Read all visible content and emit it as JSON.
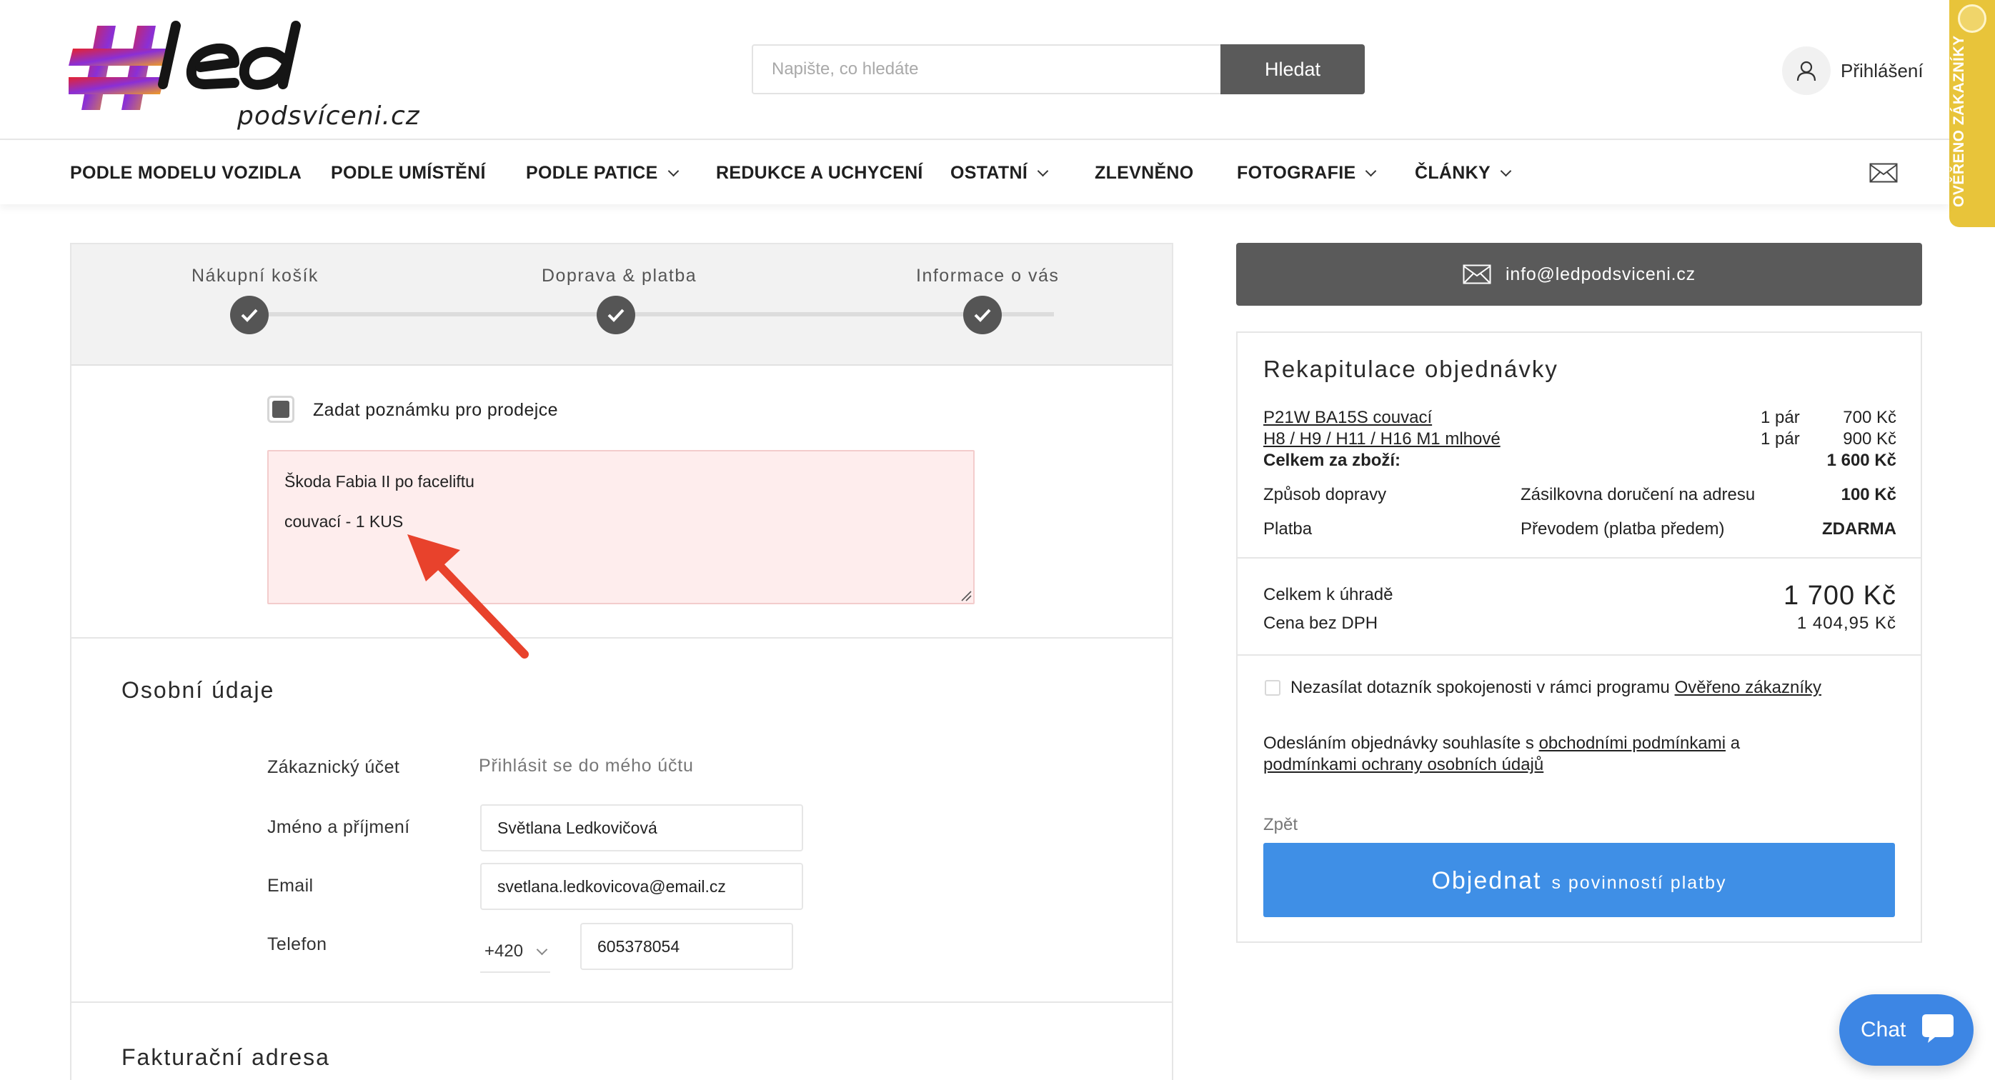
{
  "header": {
    "logo_sub": "podsvíceni.cz",
    "search_placeholder": "Napište, co hledáte",
    "search_button": "Hledat",
    "login_label": "Přihlášení",
    "badge_text": "OVĚŘENO ZÁKAZNÍKY"
  },
  "nav": {
    "items": [
      {
        "label": "PODLE MODELU VOZIDLA",
        "dropdown": false
      },
      {
        "label": "PODLE UMÍSTĚNÍ",
        "dropdown": false
      },
      {
        "label": "PODLE PATICE",
        "dropdown": true
      },
      {
        "label": "REDUKCE A UCHYCENÍ",
        "dropdown": false
      },
      {
        "label": "OSTATNÍ",
        "dropdown": true
      },
      {
        "label": "ZLEVNĚNO",
        "dropdown": false
      },
      {
        "label": "FOTOGRAFIE",
        "dropdown": true
      },
      {
        "label": "ČLÁNKY",
        "dropdown": true
      }
    ]
  },
  "steps": [
    {
      "label": "Nákupní košík",
      "done": true
    },
    {
      "label": "Doprava & platba",
      "done": true
    },
    {
      "label": "Informace o vás",
      "done": true
    }
  ],
  "note": {
    "checkbox_label": "Zadat poznámku pro prodejce",
    "checked": true,
    "lines": [
      "Škoda Fabia II po faceliftu",
      "couvací - 1 KUS"
    ]
  },
  "personal": {
    "title": "Osobní údaje",
    "account_label": "Zákaznický účet",
    "account_link": "Přihlásit se do mého účtu",
    "name_label": "Jméno a příjmení",
    "name_value": "Světlana Ledkovičová",
    "email_label": "Email",
    "email_value": "svetlana.ledkovicova@email.cz",
    "phone_label": "Telefon",
    "phone_prefix": "+420",
    "phone_value": "605378054"
  },
  "billing": {
    "title": "Fakturační adresa"
  },
  "sidebar": {
    "email": "info@ledpodsviceni.cz",
    "recap_title": "Rekapitulace objednávky",
    "items": [
      {
        "name": "P21W BA15S couvací",
        "qty": "1 pár",
        "price": "700 Kč"
      },
      {
        "name": "H8 / H9 / H11 / H16 M1 mlhové",
        "qty": "1 pár",
        "price": "900 Kč"
      }
    ],
    "goods_total_label": "Celkem za zboží:",
    "goods_total": "1 600 Kč",
    "shipping_label": "Způsob dopravy",
    "shipping_method": "Zásilkovna doručení na adresu",
    "shipping_price": "100 Kč",
    "payment_label": "Platba",
    "payment_method": "Převodem (platba předem)",
    "payment_price": "ZDARMA",
    "total_label": "Celkem k úhradě",
    "total": "1 700 Kč",
    "novat_label": "Cena bez DPH",
    "novat": "1 404,95 Kč",
    "survey_text": "Nezasílat dotazník spokojenosti v rámci programu",
    "survey_link": "Ověřeno zákazníky",
    "terms_pre": "Odesláním objednávky souhlasíte s",
    "terms_link1": "obchodními podmínkami",
    "terms_mid": "a",
    "terms_link2": "podmínkami ochrany osobních údajů",
    "back": "Zpět",
    "order_main": "Objednat",
    "order_sub": "s povinností platby"
  },
  "chat": {
    "label": "Chat"
  },
  "colors": {
    "order_button": "#3f8fe6",
    "dark_button": "#5a5a5a",
    "note_bg": "#feeded",
    "badge": "#e8c43a"
  }
}
